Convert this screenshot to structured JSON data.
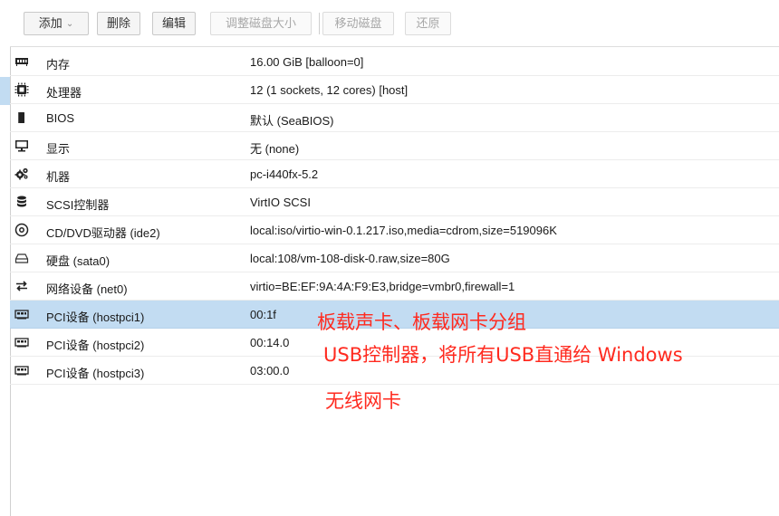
{
  "toolbar": {
    "add": "添加",
    "remove": "删除",
    "edit": "编辑",
    "resize_disk": "调整磁盘大小",
    "move_disk": "移动磁盘",
    "revert": "还原"
  },
  "hardware": {
    "rows": [
      {
        "icon": "memory-icon",
        "name": "内存",
        "value": "16.00 GiB [balloon=0]"
      },
      {
        "icon": "cpu-icon",
        "name": "处理器",
        "value": "12 (1 sockets, 12 cores) [host]"
      },
      {
        "icon": "bios-chip-icon",
        "name": "BIOS",
        "value": "默认 (SeaBIOS)"
      },
      {
        "icon": "monitor-icon",
        "name": "显示",
        "value": "无 (none)"
      },
      {
        "icon": "gears-icon",
        "name": "机器",
        "value": "pc-i440fx-5.2"
      },
      {
        "icon": "database-icon",
        "name": "SCSI控制器",
        "value": "VirtIO SCSI"
      },
      {
        "icon": "cdrom-icon",
        "name": "CD/DVD驱动器 (ide2)",
        "value": "local:iso/virtio-win-0.1.217.iso,media=cdrom,size=519096K"
      },
      {
        "icon": "harddisk-icon",
        "name": "硬盘 (sata0)",
        "value": "local:108/vm-108-disk-0.raw,size=80G"
      },
      {
        "icon": "network-exchange-icon",
        "name": "网络设备 (net0)",
        "value": "virtio=BE:EF:9A:4A:F9:E3,bridge=vmbr0,firewall=1"
      },
      {
        "icon": "pci-card-icon",
        "name": "PCI设备 (hostpci1)",
        "value": "00:1f"
      },
      {
        "icon": "pci-card-icon",
        "name": "PCI设备 (hostpci2)",
        "value": "00:14.0"
      },
      {
        "icon": "pci-card-icon",
        "name": "PCI设备 (hostpci3)",
        "value": "03:00.0"
      }
    ],
    "selected_index": 9
  },
  "annotations": [
    "板载声卡、板载网卡分组",
    "USB控制器，将所有USB直通给 Windows",
    "无线网卡"
  ],
  "colors": {
    "selected_row": "#c2dcf2",
    "annotation": "#ff2a1f"
  }
}
